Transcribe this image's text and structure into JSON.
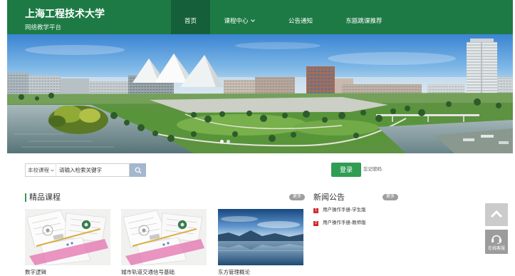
{
  "colors": {
    "header_green": "#1d7a45",
    "nav_active_green": "#15603a",
    "accent_green": "#2f9d52",
    "news_rank_red": "#d22a2a",
    "more_badge_gray": "#9e9e9e",
    "search_button": "#a3b7cd"
  },
  "header": {
    "title": "上海工程技术大学",
    "subtitle": "网络教学平台"
  },
  "nav": [
    {
      "label": "首页",
      "active": true
    },
    {
      "label": "课程中心",
      "dropdown": true
    },
    {
      "label": "公告通知"
    },
    {
      "label": "东瓯跳课推荐"
    }
  ],
  "search": {
    "scope": "本校课程",
    "placeholder": "请输入检索关键字",
    "icon": "search-icon"
  },
  "login": {
    "button": "登录",
    "forgot_password": "忘记密码"
  },
  "courses": {
    "heading": "精品课程",
    "more": "更多",
    "items": [
      {
        "title": "数字逻辑"
      },
      {
        "title": "城市轨道交通信号基础"
      },
      {
        "title": "东方管理概论"
      }
    ]
  },
  "news": {
    "heading": "新闻公告",
    "more": "更多",
    "items": [
      {
        "rank": "1",
        "title": "用户操作手册-学生版"
      },
      {
        "rank": "2",
        "title": "用户操作手册-教师版"
      }
    ]
  },
  "float_tools": {
    "back_to_top_icon": "chevron-up-icon",
    "service_icon": "headset-icon",
    "service_label": "在线客服"
  }
}
